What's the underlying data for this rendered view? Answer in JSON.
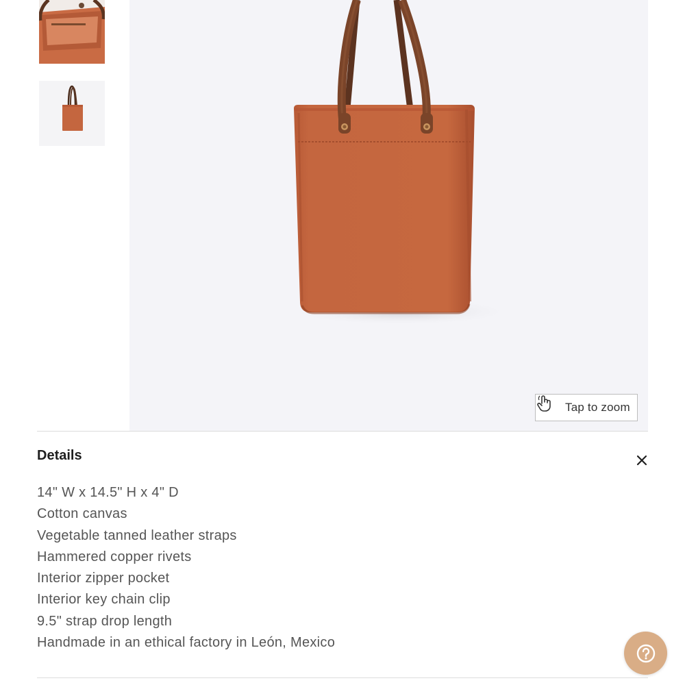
{
  "gallery": {
    "thumbnails": [
      {
        "alt": "tote-interior-view"
      },
      {
        "alt": "tote-front-view"
      }
    ]
  },
  "hero": {
    "zoom_label": "Tap to zoom"
  },
  "details": {
    "title": "Details",
    "items": [
      "14\" W x 14.5\" H x 4\" D",
      "Cotton canvas",
      "Vegetable tanned leather straps",
      "Hammered copper rivets",
      "Interior zipper pocket",
      "Interior key chain clip",
      "9.5\" strap drop length",
      "Handmade in an ethical factory in León, Mexico"
    ]
  },
  "icons": {
    "zoom": "hand-pointer-icon",
    "close": "close-icon",
    "help": "question-circle-icon"
  },
  "colors": {
    "canvas": "#c4663f",
    "leather": "#6b3b24",
    "help_button": "#d9ad86",
    "hero_background": "#f4f4f8"
  }
}
